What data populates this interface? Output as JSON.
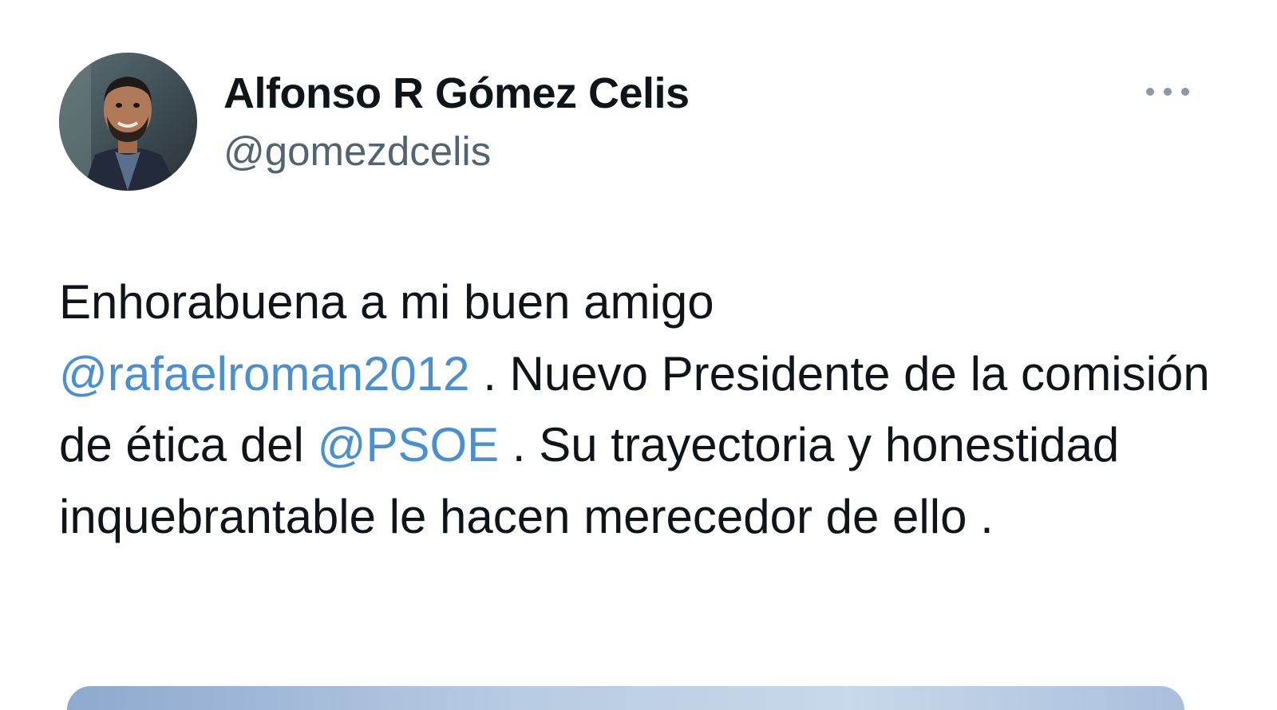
{
  "tweet": {
    "author": {
      "display_name": "Alfonso R Gómez Celis",
      "handle": "@gomezdcelis",
      "avatar_icon": "profile-photo"
    },
    "more_icon": "more-horizontal-icon",
    "text": {
      "line1": "Enhorabuena a mi buen amigo",
      "mention1": "@rafaelroman2012",
      "seg2": " . Nuevo Presidente de la comisión de ética del ",
      "mention2": "@PSOE",
      "seg3": " . Su trayectoria y honestidad inquebrantable le hacen merecedor de ello ."
    },
    "colors": {
      "text": "#0f1419",
      "secondary": "#536471",
      "link": "#4a8fd0"
    }
  }
}
